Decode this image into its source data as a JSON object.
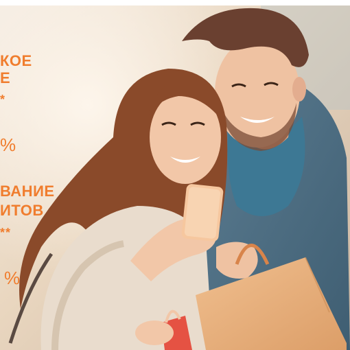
{
  "ad": {
    "line1": "КОЕ",
    "line2": "Е",
    "star1": "*",
    "pct1": "%",
    "line3": "ВАНИЕ",
    "line4": "ИТОВ",
    "star2": "**",
    "pct2": "%"
  },
  "colors": {
    "accent": "#f07d2e",
    "bag": "#e6ad78",
    "coat": "#4d6f84",
    "scarf": "#3d7894",
    "hair_woman": "#8a4a2a",
    "hair_man": "#6a4030",
    "skin": "#f0c4a4",
    "fur": "#e9dccd"
  }
}
